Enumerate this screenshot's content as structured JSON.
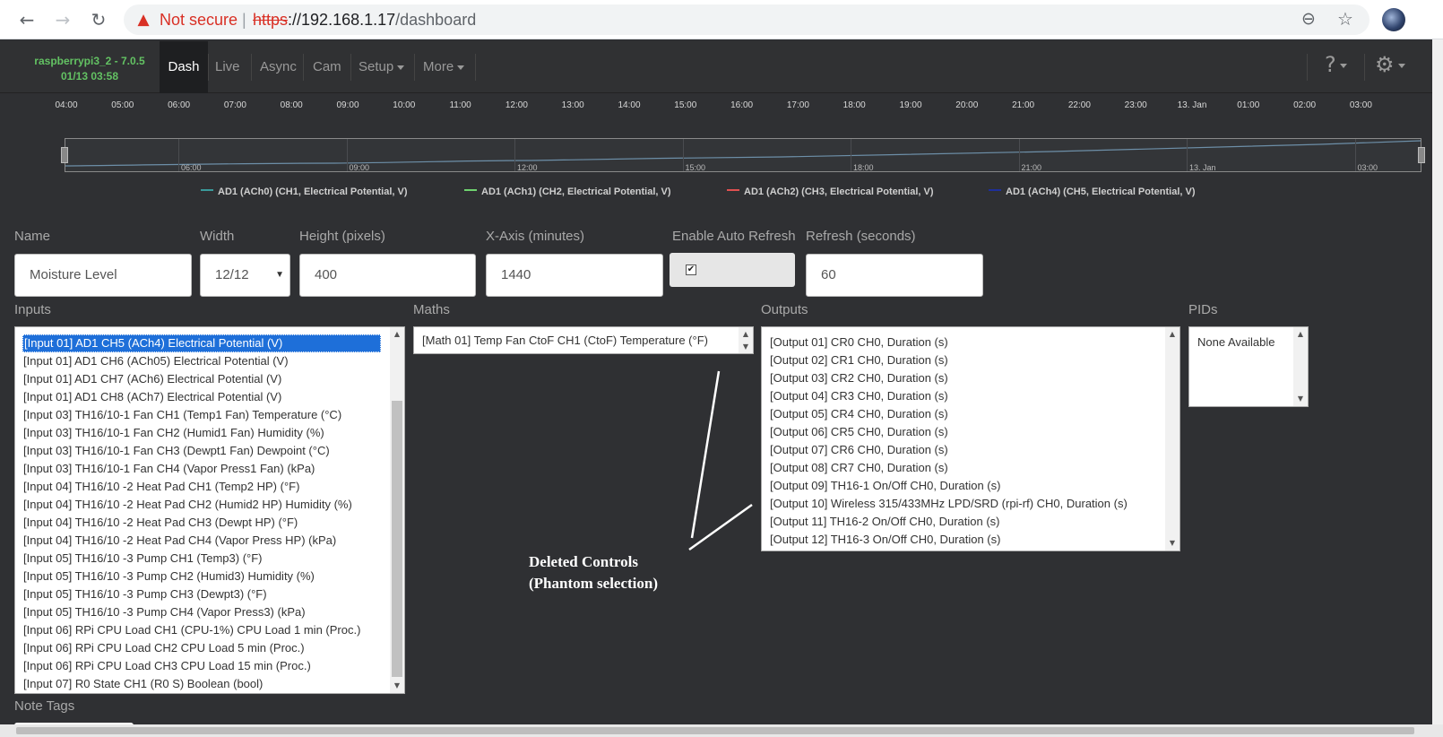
{
  "browser": {
    "back_icon": "arrow-left-icon",
    "forward_icon": "arrow-right-icon",
    "reload_icon": "reload-icon",
    "security_warning": "Not secure",
    "url_protocol": "https",
    "url_host": "://192.168.1.17",
    "url_path": "/dashboard"
  },
  "app": {
    "brand_line1": "raspberrypi3_2 - 7.0.5",
    "brand_line2": "01/13 03:58",
    "nav": {
      "dash": "Dash",
      "live": "Live",
      "async": "Async",
      "cam": "Cam",
      "setup": "Setup",
      "more": "More"
    },
    "brand_color": "#63c263"
  },
  "chart_data": {
    "type": "line",
    "x_ticks": [
      "04:00",
      "05:00",
      "06:00",
      "07:00",
      "08:00",
      "09:00",
      "10:00",
      "11:00",
      "12:00",
      "13:00",
      "14:00",
      "15:00",
      "16:00",
      "17:00",
      "18:00",
      "19:00",
      "20:00",
      "21:00",
      "22:00",
      "23:00",
      "13. Jan",
      "01:00",
      "02:00",
      "03:00"
    ],
    "navigator_ticks": [
      "06:00",
      "09:00",
      "12:00",
      "15:00",
      "18:00",
      "21:00",
      "13. Jan",
      "03:00"
    ],
    "series": [
      {
        "name": "AD1 (ACh0) (CH1, Electrical Potential, V)",
        "color": "#3a9a9a"
      },
      {
        "name": "AD1 (ACh1) (CH2, Electrical Potential, V)",
        "color": "#6fd26f"
      },
      {
        "name": "AD1 (ACh2) (CH3, Electrical Potential, V)",
        "color": "#e05050"
      },
      {
        "name": "AD1 (ACh4) (CH5, Electrical Potential, V)",
        "color": "#1e2f9a"
      }
    ]
  },
  "form": {
    "name_label": "Name",
    "name_value": "Moisture Level",
    "width_label": "Width",
    "width_value": "12/12",
    "height_label": "Height (pixels)",
    "height_value": "400",
    "xaxis_label": "X-Axis (minutes)",
    "xaxis_value": "1440",
    "autorefresh_label": "Enable Auto Refresh",
    "autorefresh_checked": "✔",
    "refresh_label": "Refresh (seconds)",
    "refresh_value": "60",
    "inputs_label": "Inputs",
    "maths_label": "Maths",
    "outputs_label": "Outputs",
    "pids_label": "PIDs",
    "note_tags_label": "Note Tags"
  },
  "inputs_list": [
    "[Input 01] AD1 CH5 (ACh4) Electrical Potential (V)",
    "[Input 01] AD1 CH6 (ACh05) Electrical Potential (V)",
    "[Input 01] AD1 CH7 (ACh6) Electrical Potential (V)",
    "[Input 01] AD1 CH8 (ACh7) Electrical Potential (V)",
    "[Input 03] TH16/10-1 Fan CH1 (Temp1 Fan) Temperature (°C)",
    "[Input 03] TH16/10-1 Fan CH2 (Humid1 Fan) Humidity (%)",
    "[Input 03] TH16/10-1 Fan CH3 (Dewpt1 Fan) Dewpoint (°C)",
    "[Input 03] TH16/10-1 Fan CH4 (Vapor Press1 Fan) (kPa)",
    "[Input 04] TH16/10 -2 Heat Pad CH1 (Temp2 HP) (°F)",
    "[Input 04] TH16/10 -2 Heat Pad CH2 (Humid2 HP) Humidity (%)",
    "[Input 04] TH16/10 -2 Heat Pad CH3 (Dewpt HP) (°F)",
    "[Input 04] TH16/10 -2 Heat Pad CH4 (Vapor Press HP) (kPa)",
    "[Input 05] TH16/10 -3 Pump CH1 (Temp3) (°F)",
    "[Input 05] TH16/10 -3 Pump CH2 (Humid3) Humidity (%)",
    "[Input 05] TH16/10 -3 Pump CH3 (Dewpt3) (°F)",
    "[Input 05] TH16/10 -3 Pump CH4 (Vapor Press3) (kPa)",
    "[Input 06] RPi CPU Load CH1 (CPU-1%) CPU Load 1 min (Proc.)",
    "[Input 06] RPi CPU Load CH2 CPU Load 5 min (Proc.)",
    "[Input 06] RPi CPU Load CH3 CPU Load 15 min (Proc.)",
    "[Input 07] R0 State CH1 (R0 S) Boolean (bool)"
  ],
  "maths_list": [
    "[Math 01] Temp Fan CtoF CH1 (CtoF) Temperature (°F)"
  ],
  "outputs_list": [
    "[Output 01] CR0 CH0, Duration (s)",
    "[Output 02] CR1 CH0, Duration (s)",
    "[Output 03] CR2 CH0, Duration (s)",
    "[Output 04] CR3 CH0, Duration (s)",
    "[Output 05] CR4 CH0, Duration (s)",
    "[Output 06] CR5 CH0, Duration (s)",
    "[Output 07] CR6 CH0, Duration (s)",
    "[Output 08] CR7 CH0, Duration (s)",
    "[Output 09] TH16-1 On/Off CH0, Duration (s)",
    "[Output 10] Wireless 315/433MHz LPD/SRD (rpi-rf) CH0, Duration (s)",
    "[Output 11] TH16-2 On/Off CH0, Duration (s)",
    "[Output 12] TH16-3 On/Off CH0, Duration (s)"
  ],
  "pids_list": [
    "None Available"
  ],
  "annotation": {
    "line1": "Deleted Controls",
    "line2": "(Phantom selection)"
  }
}
